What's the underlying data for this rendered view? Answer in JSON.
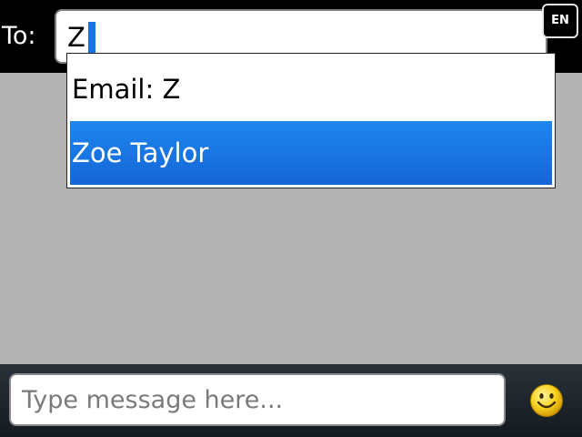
{
  "header": {
    "to_label": "To:",
    "recipient_value": "Z",
    "input_language": "EN"
  },
  "suggestions": {
    "items": [
      {
        "label": "Email: Z",
        "selected": false
      },
      {
        "label": "Zoe Taylor",
        "selected": true
      }
    ]
  },
  "compose": {
    "placeholder": "Type message here...",
    "emoji_icon": "smiley-icon"
  },
  "colors": {
    "selection": "#1a73e0",
    "header_bg": "#000000",
    "body_bg": "#b3b3b3"
  }
}
